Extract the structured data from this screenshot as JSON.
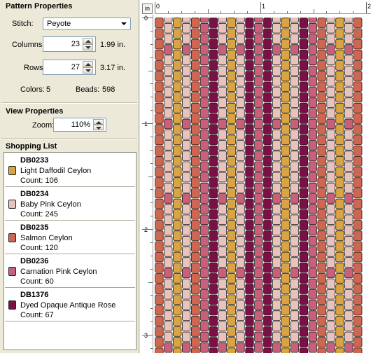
{
  "pattern_properties": {
    "title": "Pattern Properties",
    "stitch_label": "Stitch:",
    "stitch_value": "Peyote",
    "columns_label": "Columns:",
    "columns_value": "23",
    "columns_inches": "1.99 in.",
    "rows_label": "Rows:",
    "rows_value": "27",
    "rows_inches": "3.17 in.",
    "colors_label": "Colors:",
    "colors_value": "5",
    "beads_label": "Beads:",
    "beads_value": "598"
  },
  "view_properties": {
    "title": "View Properties",
    "zoom_label": "Zoom:",
    "zoom_value": "110%"
  },
  "shopping_list": {
    "title": "Shopping List",
    "items": [
      {
        "code": "DB0233",
        "name": "Light Daffodil Ceylon",
        "count": "Count: 106",
        "color": "#d9a441"
      },
      {
        "code": "DB0234",
        "name": "Baby Pink Ceylon",
        "count": "Count: 245",
        "color": "#e8c3bb"
      },
      {
        "code": "DB0235",
        "name": "Salmon Ceylon",
        "count": "Count: 120",
        "color": "#cf6650"
      },
      {
        "code": "DB0236",
        "name": "Carnation Pink Ceylon",
        "count": "Count: 60",
        "color": "#c95f78"
      },
      {
        "code": "DB1376",
        "name": "Dyed Opaque Antique Rose",
        "count": "Count: 67",
        "color": "#7a1045"
      }
    ]
  },
  "canvas": {
    "unit_button": "in",
    "h_ruler_labels": [
      "0",
      "1",
      "2"
    ],
    "v_ruler_labels": [
      "0",
      "1",
      "2",
      "3"
    ]
  }
}
